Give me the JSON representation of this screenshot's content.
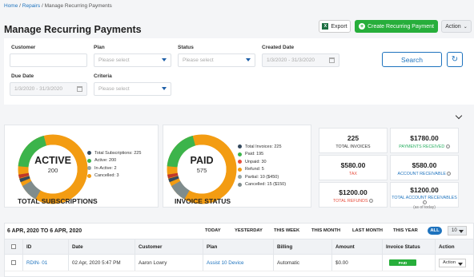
{
  "breadcrumb": {
    "home": "Home",
    "sep": " / ",
    "repairs": "Repairs",
    "current": "Manage Recurring Payments"
  },
  "page_title": "Manage Recurring Payments",
  "toolbar": {
    "export_label": "Export",
    "create_label": "Create Recurring Payment",
    "action_label": "Action"
  },
  "filters": {
    "customer_label": "Customer",
    "plan_label": "Plan",
    "plan_placeholder": "Please select",
    "status_label": "Status",
    "status_placeholder": "Please select",
    "created_label": "Created Date",
    "created_value": "1/3/2020 - 31/3/2020",
    "due_label": "Due Date",
    "due_value": "1/3/2020 - 31/3/2020",
    "criteria_label": "Criteria",
    "criteria_placeholder": "Please select",
    "search_label": "Search"
  },
  "subscriptions": {
    "center_label": "ACTIVE",
    "center_value": "200",
    "title": "TOTAL SUBSCRIPTIONS",
    "legend": [
      {
        "text": "Total Subscriptions: 225",
        "color": "#34495e"
      },
      {
        "text": "Active: 200",
        "color": "#3cb44b"
      },
      {
        "text": "In-Active: 2",
        "color": "#95a5a6"
      },
      {
        "text": "Cancelled: 3",
        "color": "#f39c12"
      }
    ],
    "ring_colors": [
      "#f39c12",
      "#3cb44b",
      "#c0392b",
      "#34495e",
      "#7f8c8d"
    ]
  },
  "invoices": {
    "center_label": "PAID",
    "center_value": "575",
    "title": "INVOICE STATUS",
    "legend": [
      {
        "text": "Total Invoices: 225",
        "color": "#34495e"
      },
      {
        "text": "Paid: 195",
        "color": "#3cb44b"
      },
      {
        "text": "Unpaid: 30",
        "color": "#e74c3c"
      },
      {
        "text": "Refund: 5",
        "color": "#f39c12"
      },
      {
        "text": "Partial: 10 ($450)",
        "color": "#95a5a6"
      },
      {
        "text": "Cancelled: 15 ($150)",
        "color": "#7f8c8d"
      }
    ]
  },
  "stats": [
    {
      "value": "225",
      "label": "TOTAL INVOICES",
      "color": "#333333",
      "sub": ""
    },
    {
      "value": "$1780.00",
      "label": "PAYMENTS RECEIVED",
      "color": "#27ae60",
      "sub": ""
    },
    {
      "value": "$580.00",
      "label": "TAX",
      "color": "#e74c3c",
      "sub": ""
    },
    {
      "value": "$580.00",
      "label": "ACCOUNT RECEIVABLE",
      "color": "#1e73be",
      "sub": ""
    },
    {
      "value": "$1200.00",
      "label": "TOTAL REFUNDS",
      "color": "#e74c3c",
      "sub": ""
    },
    {
      "value": "$1200.00",
      "label": "TOTAL ACCOUNT RECEIVABLES",
      "color": "#1e73be",
      "sub": "(as of today)"
    }
  ],
  "table": {
    "date_range": "6 APR, 2020 TO 6 APR, 2020",
    "tabs": [
      "TODAY",
      "YESTERDAY",
      "THIS WEEK",
      "THIS MONTH",
      "LAST MONTH",
      "THIS YEAR"
    ],
    "tab_all": "ALL",
    "page_size": "10",
    "headers": [
      "ID",
      "Date",
      "Customer",
      "Plan",
      "Billing",
      "Amount",
      "Invoice Status",
      "Action"
    ],
    "rows": [
      {
        "id": "RDIN- 01",
        "date": "02 Apr, 2020 5:47 PM",
        "customer": "Aaron Lowry",
        "plan": "Assist 10 Device",
        "billing": "Automatic",
        "amount": "$0.00",
        "status": "PAID",
        "action": "Action"
      }
    ]
  }
}
